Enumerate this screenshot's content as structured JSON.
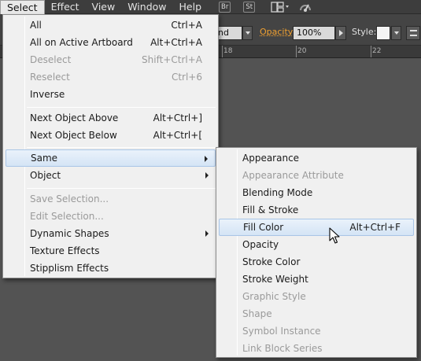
{
  "menubar": {
    "items": [
      "Select",
      "Effect",
      "View",
      "Window",
      "Help"
    ],
    "active": "Select",
    "badges": [
      "Br",
      "St"
    ],
    "icons": [
      "arrange-documents-icon",
      "gpu-performance-icon"
    ]
  },
  "controlbar": {
    "blend_value": "nd",
    "opacity_label": "Opacity:",
    "opacity_value": "100%",
    "style_label": "Style:"
  },
  "ruler": {
    "labels": [
      "18",
      "20",
      "22"
    ]
  },
  "select_menu": {
    "items": [
      {
        "label": "All",
        "shortcut": "Ctrl+A",
        "enabled": true
      },
      {
        "label": "All on Active Artboard",
        "shortcut": "Alt+Ctrl+A",
        "enabled": true
      },
      {
        "label": "Deselect",
        "shortcut": "Shift+Ctrl+A",
        "enabled": false
      },
      {
        "label": "Reselect",
        "shortcut": "Ctrl+6",
        "enabled": false
      },
      {
        "label": "Inverse",
        "shortcut": "",
        "enabled": true
      },
      {
        "label": "Next Object Above",
        "shortcut": "Alt+Ctrl+]",
        "enabled": true
      },
      {
        "label": "Next Object Below",
        "shortcut": "Alt+Ctrl+[",
        "enabled": true
      },
      {
        "label": "Same",
        "submenu": true,
        "enabled": true,
        "highlighted": true
      },
      {
        "label": "Object",
        "submenu": true,
        "enabled": true
      },
      {
        "label": "Save Selection...",
        "shortcut": "",
        "enabled": false
      },
      {
        "label": "Edit Selection...",
        "shortcut": "",
        "enabled": false
      },
      {
        "label": "Dynamic Shapes",
        "submenu": true,
        "enabled": true
      },
      {
        "label": "Texture Effects",
        "shortcut": "",
        "enabled": true
      },
      {
        "label": "Stipplism Effects",
        "shortcut": "",
        "enabled": true
      }
    ]
  },
  "same_submenu": {
    "items": [
      {
        "label": "Appearance",
        "enabled": true
      },
      {
        "label": "Appearance Attribute",
        "enabled": false
      },
      {
        "label": "Blending Mode",
        "enabled": true
      },
      {
        "label": "Fill & Stroke",
        "enabled": true
      },
      {
        "label": "Fill Color",
        "shortcut": "Alt+Ctrl+F",
        "enabled": true,
        "highlighted": true
      },
      {
        "label": "Opacity",
        "enabled": true
      },
      {
        "label": "Stroke Color",
        "enabled": true
      },
      {
        "label": "Stroke Weight",
        "enabled": true
      },
      {
        "label": "Graphic Style",
        "enabled": false
      },
      {
        "label": "Shape",
        "enabled": false
      },
      {
        "label": "Symbol Instance",
        "enabled": false
      },
      {
        "label": "Link Block Series",
        "enabled": false
      }
    ]
  },
  "colors": {
    "menubar_bg": "#3d3d3d",
    "menu_bg": "#f0f0f0",
    "highlight": "#d4e4f5",
    "disabled_text": "#9a9a9a",
    "opacity_link": "#f0a030"
  }
}
